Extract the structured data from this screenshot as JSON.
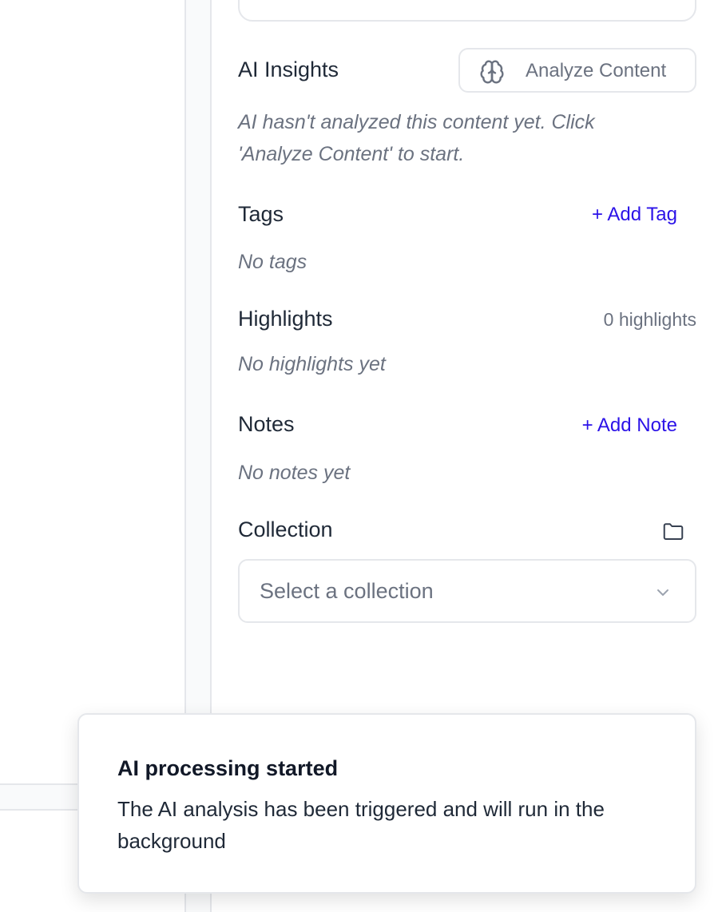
{
  "ai_insights": {
    "title": "AI Insights",
    "analyze_button": "Analyze Content",
    "analyze_icon": "brain-icon",
    "empty_message": "AI hasn't analyzed this content yet. Click 'Analyze Content' to start."
  },
  "tags": {
    "title": "Tags",
    "add_label": "+ Add Tag",
    "empty_message": "No tags"
  },
  "highlights": {
    "title": "Highlights",
    "count_label": "0 highlights",
    "empty_message": "No highlights yet"
  },
  "notes": {
    "title": "Notes",
    "add_label": "+ Add Note",
    "empty_message": "No notes yet"
  },
  "collection": {
    "title": "Collection",
    "icon": "folder-icon",
    "select_placeholder": "Select a collection"
  },
  "toast": {
    "title": "AI processing started",
    "description": "The AI analysis has been triggered and will run in the background"
  },
  "colors": {
    "accent_link": "#2b12e8",
    "muted_text": "#6b7280",
    "border": "#e5e7eb"
  }
}
